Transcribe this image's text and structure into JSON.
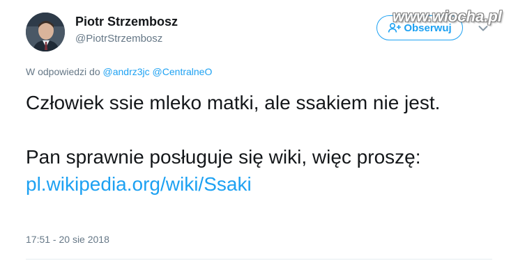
{
  "watermark": "www.wiocha.pl",
  "author": {
    "name": "Piotr Strzembosz",
    "handle": "@PiotrStrzembosz"
  },
  "follow_button": {
    "label": "Obserwuj",
    "icon": "add-user-icon"
  },
  "menu_icon": "chevron-down-icon",
  "reply": {
    "prefix": "W odpowiedzi do",
    "mentions": [
      "@andrz3jc",
      "@CentralneO"
    ]
  },
  "tweet": {
    "line1": "Człowiek ssie mleko matki, ale ssakiem nie jest.",
    "line2": "Pan sprawnie posługuje się wiki, więc proszę:",
    "link": "pl.wikipedia.org/wiki/Ssaki"
  },
  "timestamp": "17:51 - 20 sie 2018",
  "colors": {
    "accent": "#1da1f2",
    "text": "#14171a",
    "muted": "#657786",
    "divider": "#e6ecf0"
  }
}
